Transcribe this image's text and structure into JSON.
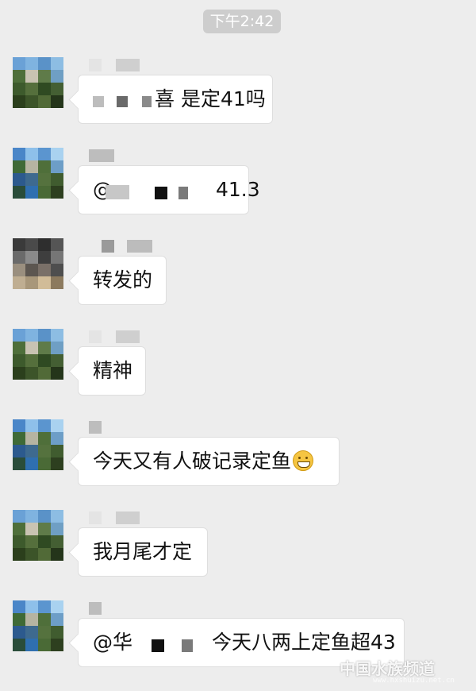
{
  "timestamp": "下午2:42",
  "messages": [
    {
      "text_before": "",
      "text": "喜 是定41吗"
    },
    {
      "text_before": "@",
      "text": "41.3"
    },
    {
      "text_before": "",
      "text": "转发的"
    },
    {
      "text_before": "",
      "text": "精神"
    },
    {
      "text_before": "",
      "text": "今天又有人破记录定鱼",
      "emoji": "grinning-face-icon"
    },
    {
      "text_before": "",
      "text": "我月尾才定"
    },
    {
      "text_before": "@华",
      "text": "今天八两上定鱼超43"
    }
  ],
  "watermark": {
    "text": "中国水族频道",
    "url": "www.hxshuizu.net.cn"
  },
  "colors": {
    "background": "#ededed",
    "bubble": "#ffffff",
    "timestamp_bg": "#cdcdcd"
  }
}
